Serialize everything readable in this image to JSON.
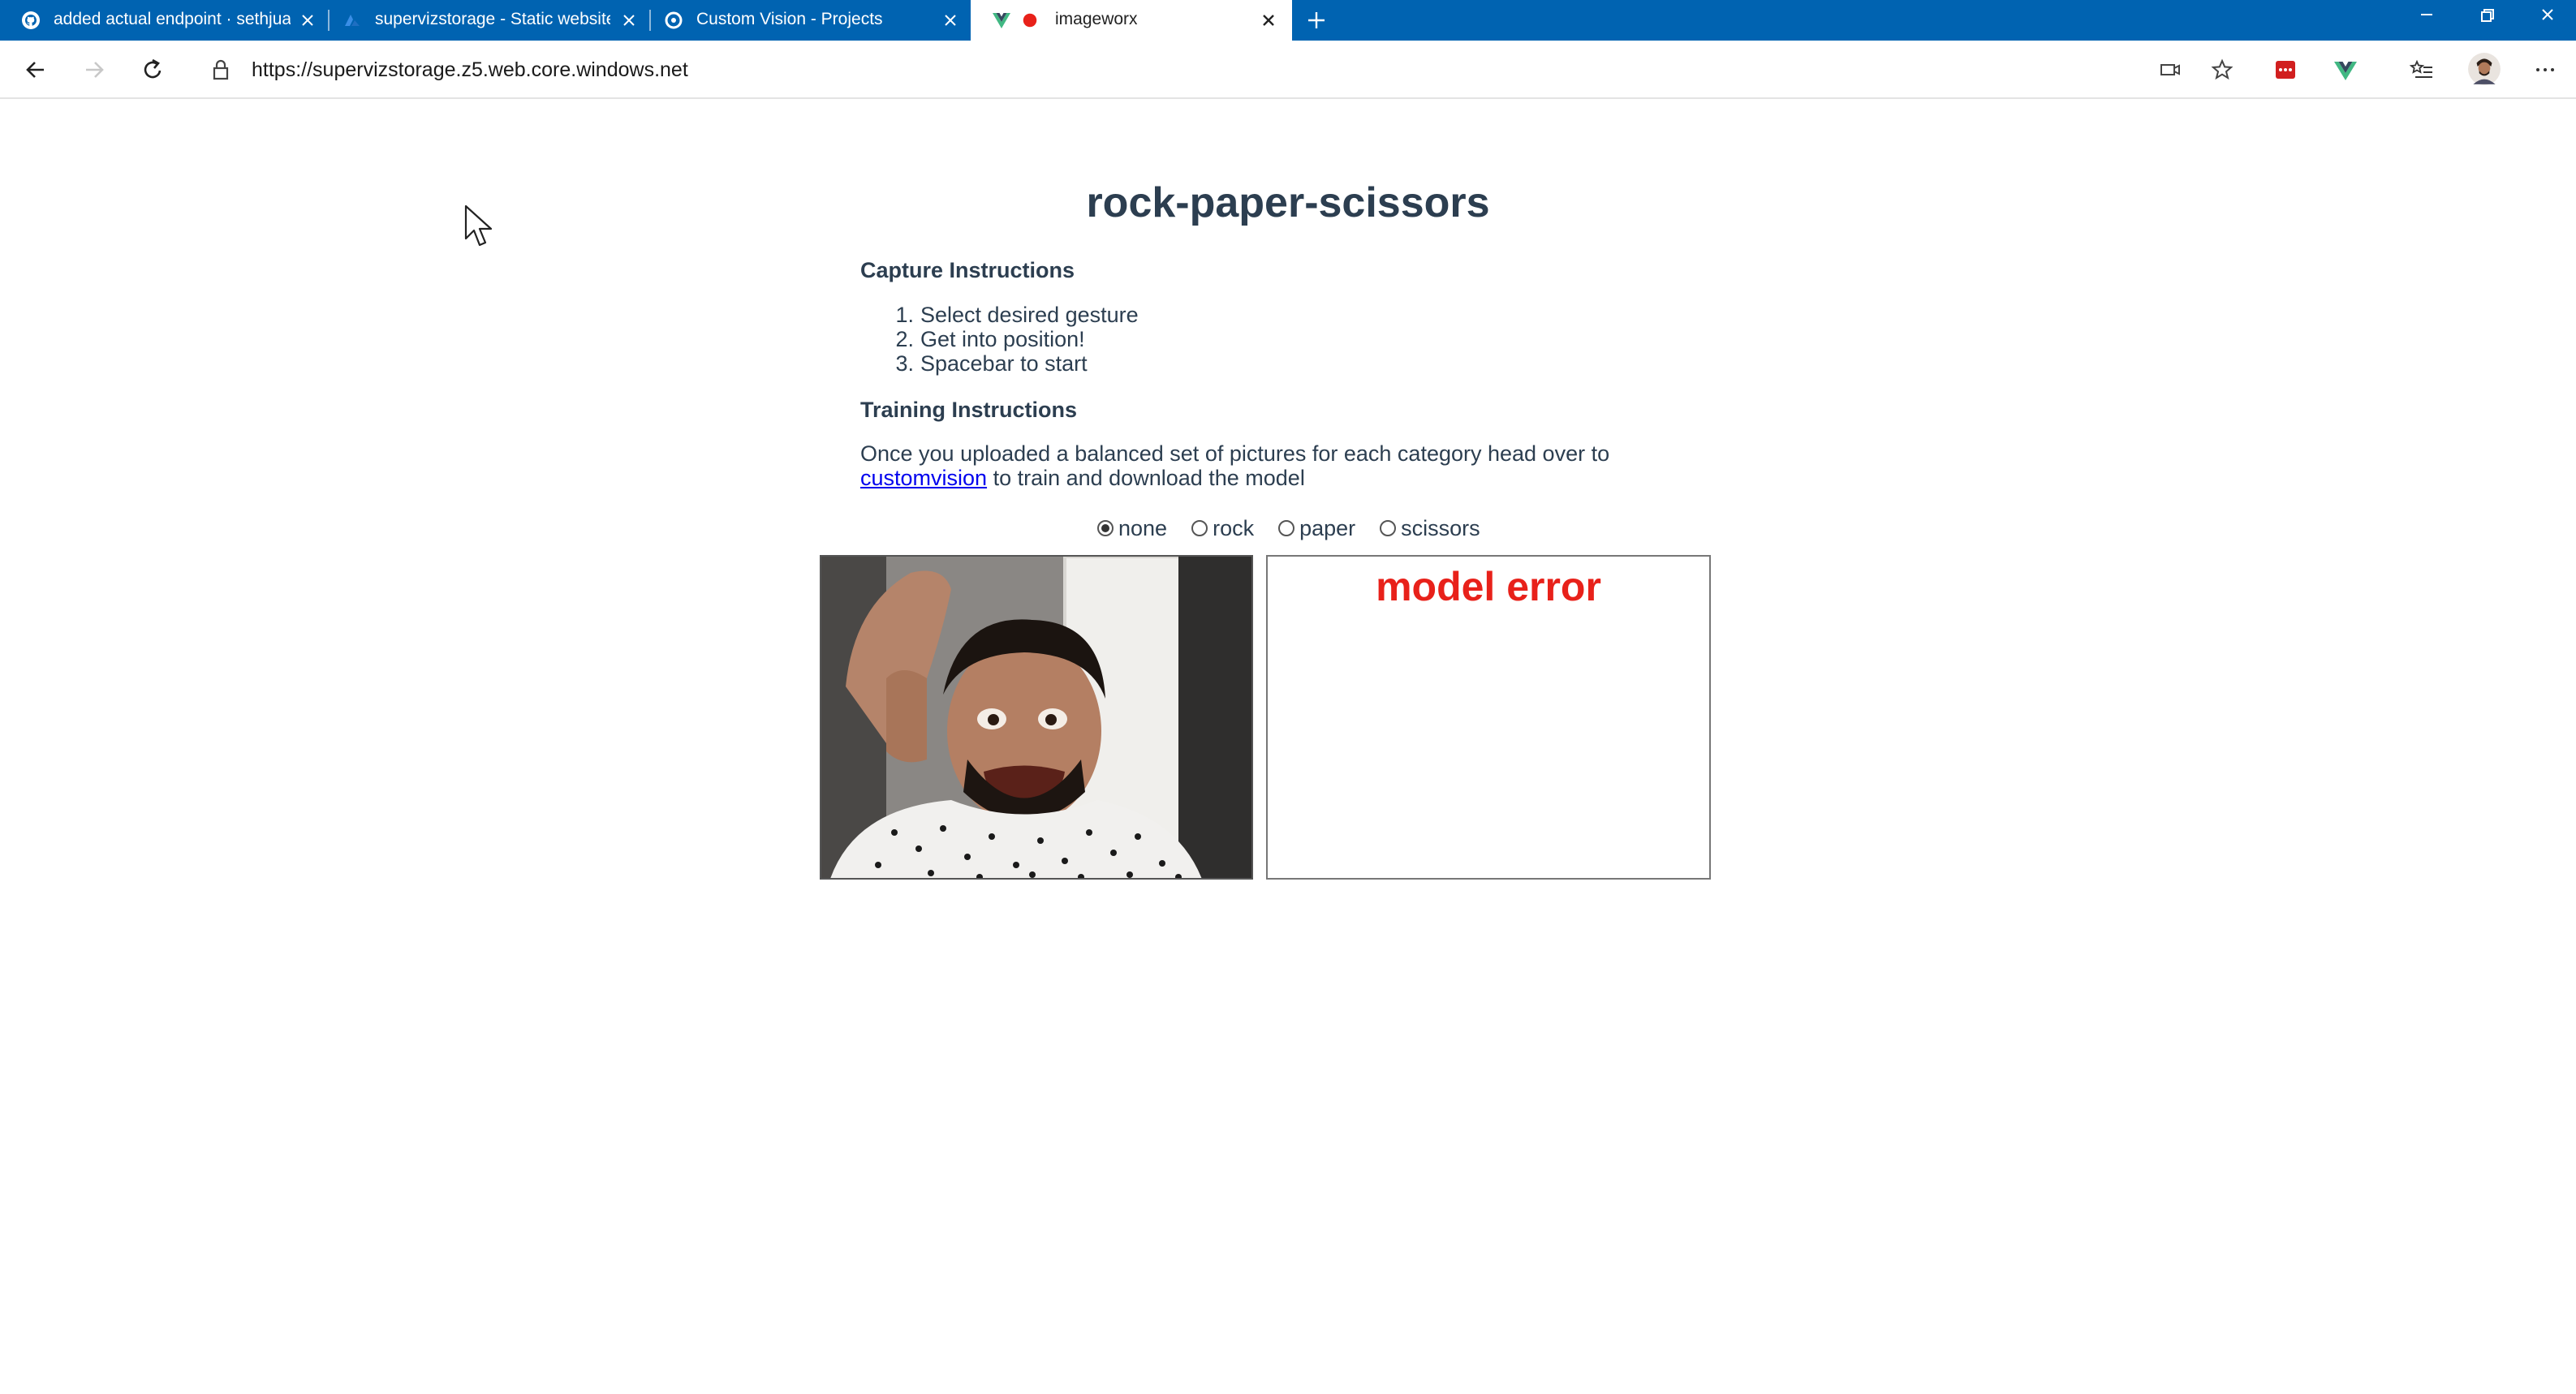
{
  "browser": {
    "tabs": [
      {
        "title": "added actual endpoint · sethjuar",
        "icon": "github-icon",
        "active": false
      },
      {
        "title": "supervizstorage - Static website",
        "icon": "azure-icon",
        "active": false
      },
      {
        "title": "Custom Vision - Projects",
        "icon": "customvision-icon",
        "active": false
      },
      {
        "title": "imageworx",
        "icon": "vue-icon",
        "active": true,
        "recording": true
      }
    ],
    "new_tab_icon": "plus-icon",
    "url": "https://supervizstorage.z5.web.core.windows.net",
    "colors": {
      "tabstrip": "#0063b1",
      "accent_red": "#e8211a",
      "title_text": "#2c3e50"
    }
  },
  "page": {
    "title": "rock-paper-scissors",
    "capture": {
      "heading": "Capture Instructions",
      "steps": [
        {
          "num": "1.",
          "text": "Select desired gesture"
        },
        {
          "num": "2.",
          "text": "Get into position!"
        },
        {
          "num": "3.",
          "text": "Spacebar to start"
        }
      ]
    },
    "training": {
      "heading": "Training Instructions",
      "text_before": "Once you uploaded a balanced set of pictures for each category head over to",
      "link_text": "customvision",
      "text_after": " to train and download the model"
    },
    "gestures": {
      "selected": "none",
      "options": [
        {
          "label": "none",
          "checked": true
        },
        {
          "label": "rock",
          "checked": false
        },
        {
          "label": "paper",
          "checked": false
        },
        {
          "label": "scissors",
          "checked": false
        }
      ]
    },
    "result": {
      "text": "model error"
    }
  }
}
